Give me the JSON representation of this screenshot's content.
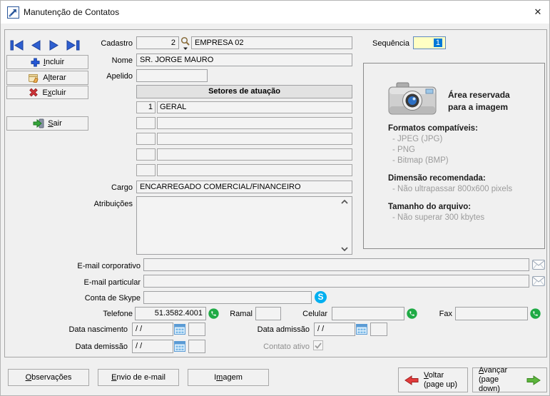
{
  "window": {
    "title": "Manutenção de Contatos",
    "close_glyph": "✕"
  },
  "toolbar": {
    "incluir": {
      "label": "Incluir",
      "key": "I"
    },
    "alterar": {
      "label": "Alterar",
      "key": "l"
    },
    "excluir": {
      "label": "Excluir",
      "key": "x"
    },
    "sair": {
      "label": "Sair",
      "key": "S"
    }
  },
  "fields": {
    "cadastro": {
      "label": "Cadastro",
      "code": "2",
      "name": "EMPRESA 02"
    },
    "sequencia": {
      "label": "Sequência",
      "value": "1"
    },
    "nome": {
      "label": "Nome",
      "value": "SR. JORGE MAURO"
    },
    "apelido": {
      "label": "Apelido",
      "value": ""
    },
    "cargo": {
      "label": "Cargo",
      "value": "ENCARREGADO COMERCIAL/FINANCEIRO"
    },
    "atribuicoes": {
      "label": "Atribuições",
      "value": ""
    },
    "email_corporativo": {
      "label": "E-mail corporativo",
      "value": ""
    },
    "email_particular": {
      "label": "E-mail particular",
      "value": ""
    },
    "skype": {
      "label": "Conta de Skype",
      "value": ""
    },
    "telefone": {
      "label": "Telefone",
      "value": "51.3582.4001"
    },
    "ramal": {
      "label": "Ramal",
      "value": ""
    },
    "celular": {
      "label": "Celular",
      "value": ""
    },
    "fax": {
      "label": "Fax",
      "value": ""
    },
    "data_nascimento": {
      "label": "Data nascimento",
      "value": "/ /"
    },
    "data_admissao": {
      "label": "Data admissão",
      "value": "/ /"
    },
    "data_demissao": {
      "label": "Data demissão",
      "value": "/ /"
    },
    "contato_ativo": {
      "label": "Contato ativo",
      "checked": true
    }
  },
  "table": {
    "header": "Setores de atuação",
    "rows": [
      {
        "num": "1",
        "name": "GERAL"
      },
      {
        "num": "",
        "name": ""
      },
      {
        "num": "",
        "name": ""
      },
      {
        "num": "",
        "name": ""
      },
      {
        "num": "",
        "name": ""
      }
    ]
  },
  "image_panel": {
    "reserved_line1": "Área reservada",
    "reserved_line2": "para a imagem",
    "formats_title": "Formatos compatíveis:",
    "formats": [
      "- JPEG (JPG)",
      "- PNG",
      "- Bitmap (BMP)"
    ],
    "dimension_title": "Dimensão recomendada:",
    "dimension_item": "- Não ultrapassar 800x600 pixels",
    "size_title": "Tamanho do arquivo:",
    "size_item": "- Não superar 300 kbytes"
  },
  "footer": {
    "observacoes": {
      "label": "Observações",
      "key": "O"
    },
    "envio": {
      "label": "Envio de e-mail",
      "key": "E"
    },
    "imagem": {
      "label": "Imagem",
      "key": "m"
    },
    "voltar": {
      "line1": "Voltar",
      "line2": "(page up)",
      "key": "V"
    },
    "avancar": {
      "line1": "Avançar",
      "line2": "(page down)",
      "key": "A"
    }
  },
  "icons": {
    "skype_glyph": "S"
  }
}
